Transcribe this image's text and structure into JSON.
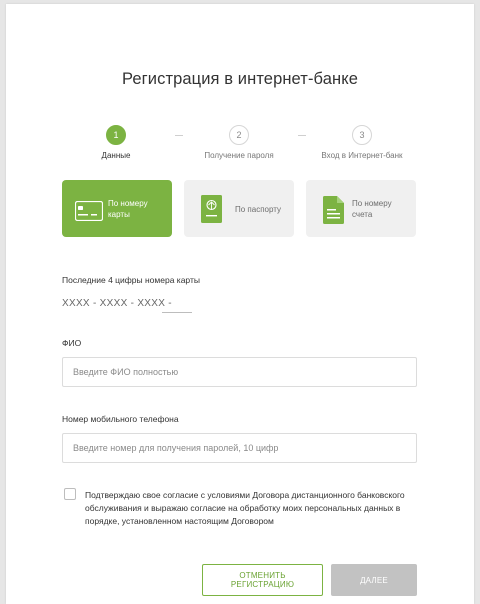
{
  "page": {
    "title": "Регистрация в интернет-банке"
  },
  "steps": [
    {
      "number": "1",
      "label": "Данные",
      "active": true
    },
    {
      "number": "2",
      "label": "Получение пароля",
      "active": false
    },
    {
      "number": "3",
      "label": "Вход в Интернет-банк",
      "active": false
    }
  ],
  "methods": [
    {
      "label": "По номеру карты",
      "icon": "card-icon",
      "selected": true
    },
    {
      "label": "По паспорту",
      "icon": "passport-icon",
      "selected": false
    },
    {
      "label": "По номеру счета",
      "icon": "document-icon",
      "selected": false
    }
  ],
  "form": {
    "card_digits": {
      "label": "Последние 4 цифры номера карты",
      "mask": "XXXX - XXXX - XXXX -",
      "value": ""
    },
    "fio": {
      "label": "ФИО",
      "placeholder": "Введите ФИО полностью",
      "value": ""
    },
    "phone": {
      "label": "Номер мобильного телефона",
      "placeholder": "Введите номер для получения паролей, 10 цифр",
      "value": ""
    },
    "consent": {
      "text": "Подтверждаю свое согласие с условиями Договора дистанционного банковского обслуживания и выражаю согласие на обработку моих персональных данных в порядке, установленном настоящим Договором",
      "checked": false
    }
  },
  "buttons": {
    "cancel": "ОТМЕНИТЬ РЕГИСТРАЦИЮ",
    "next": "ДАЛЕЕ"
  },
  "colors": {
    "accent": "#7cb342",
    "tile_inactive": "#f0f0f0",
    "button_disabled": "#c2c2c2"
  }
}
